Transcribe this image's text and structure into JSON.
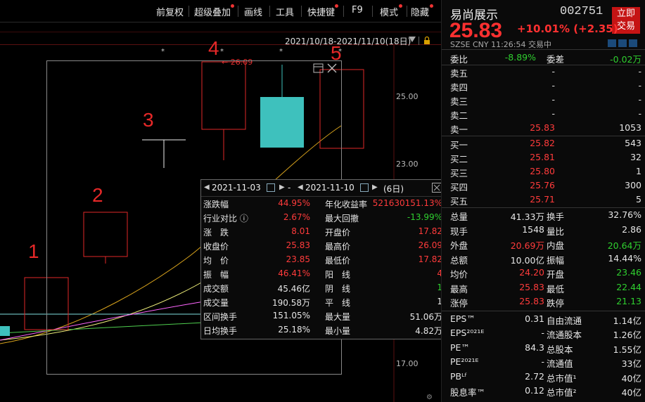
{
  "toolbar": {
    "items": [
      "前复权",
      "超级叠加",
      "画线",
      "工具",
      "快捷键",
      "F9",
      "模式",
      "隐藏"
    ]
  },
  "chart": {
    "range": "2021/10/18-2021/11/10(18日)",
    "price_labels": [
      "25.00",
      "23.00",
      "17.00"
    ],
    "marker_label": "← 26.09",
    "annotations": [
      "1",
      "2",
      "3",
      "4",
      "5"
    ]
  },
  "tooltip": {
    "start_date": "2021-11-03",
    "end_date": "2021-11-10",
    "sep": "-",
    "days": "(6日)",
    "rows": [
      {
        "l1": "涨跌幅",
        "v1": "44.95%",
        "c1": "red",
        "l2": "年化收益率",
        "v2": "521630151.13%",
        "c2": "red"
      },
      {
        "l1": "行业对比 ⓘ",
        "v1": "2.67%",
        "c1": "red",
        "l2": "最大回撤",
        "v2": "-13.99%",
        "c2": "green"
      },
      {
        "l1": "涨　跌",
        "v1": "8.01",
        "c1": "red",
        "l2": "开盘价",
        "v2": "17.82",
        "c2": "red"
      },
      {
        "l1": "收盘价",
        "v1": "25.83",
        "c1": "red",
        "l2": "最高价",
        "v2": "26.09",
        "c2": "red"
      },
      {
        "l1": "均　价",
        "v1": "23.85",
        "c1": "red",
        "l2": "最低价",
        "v2": "17.82",
        "c2": "red"
      },
      {
        "l1": "振　幅",
        "v1": "46.41%",
        "c1": "red",
        "l2": "阳　线",
        "v2": "4",
        "c2": "red"
      },
      {
        "l1": "成交额",
        "v1": "45.46亿",
        "c1": "wht",
        "l2": "阴　线",
        "v2": "1",
        "c2": "green"
      },
      {
        "l1": "成交量",
        "v1": "190.58万",
        "c1": "wht",
        "l2": "平　线",
        "v2": "1",
        "c2": "wht"
      },
      {
        "l1": "区间换手",
        "v1": "151.05%",
        "c1": "wht",
        "l2": "最大量",
        "v2": "51.06万",
        "c2": "wht"
      },
      {
        "l1": "日均换手",
        "v1": "25.18%",
        "c1": "wht",
        "l2": "最小量",
        "v2": "4.82万",
        "c2": "wht"
      }
    ]
  },
  "panel": {
    "name": "易尚展示",
    "code": "002751",
    "trade_btn": [
      "立即",
      "交易"
    ],
    "price": "25.83",
    "change": "+10.01%  (+2.35)",
    "sub": "SZSE  CNY  11:26:54  交易中",
    "weibi": {
      "l": "委比",
      "v": "-8.89%",
      "l2": "委差",
      "v2": "-0.02万"
    },
    "sells": [
      {
        "l": "卖五",
        "p": "-",
        "v": "-"
      },
      {
        "l": "卖四",
        "p": "-",
        "v": "-"
      },
      {
        "l": "卖三",
        "p": "-",
        "v": "-"
      },
      {
        "l": "卖二",
        "p": "-",
        "v": "-"
      },
      {
        "l": "卖一",
        "p": "25.83",
        "v": "1053"
      }
    ],
    "buys": [
      {
        "l": "买一",
        "p": "25.82",
        "v": "543"
      },
      {
        "l": "买二",
        "p": "25.81",
        "v": "32"
      },
      {
        "l": "买三",
        "p": "25.80",
        "v": "1"
      },
      {
        "l": "买四",
        "p": "25.76",
        "v": "300"
      },
      {
        "l": "买五",
        "p": "25.71",
        "v": "5"
      }
    ],
    "stats": [
      {
        "l1": "总量",
        "v1": "41.33万",
        "c1": "wht",
        "l2": "换手",
        "v2": "32.76%",
        "c2": "wht"
      },
      {
        "l1": "现手",
        "v1": "1548",
        "c1": "wht",
        "l2": "量比",
        "v2": "2.86",
        "c2": "wht"
      },
      {
        "l1": "外盘",
        "v1": "20.69万",
        "c1": "red",
        "l2": "内盘",
        "v2": "20.64万",
        "c2": "green"
      },
      {
        "l1": "总额",
        "v1": "10.00亿",
        "c1": "wht",
        "l2": "振幅",
        "v2": "14.44%",
        "c2": "wht"
      },
      {
        "l1": "均价",
        "v1": "24.20",
        "c1": "red",
        "l2": "开盘",
        "v2": "23.46",
        "c2": "green"
      },
      {
        "l1": "最高",
        "v1": "25.83",
        "c1": "red",
        "l2": "最低",
        "v2": "22.44",
        "c2": "green"
      },
      {
        "l1": "涨停",
        "v1": "25.83",
        "c1": "red",
        "l2": "跌停",
        "v2": "21.13",
        "c2": "green"
      }
    ],
    "fund": [
      {
        "l1": "EPS™",
        "v1": "0.31",
        "l2": "自由流通",
        "v2": "1.14亿"
      },
      {
        "l1": "EPS²⁰²¹ᴱ",
        "v1": "-",
        "l2": "流通股本",
        "v2": "1.26亿"
      },
      {
        "l1": "PE™",
        "v1": "84.3",
        "l2": "总股本",
        "v2": "1.55亿"
      },
      {
        "l1": "PE²⁰²¹ᴱ",
        "v1": "-",
        "l2": "流通值",
        "v2": "33亿"
      },
      {
        "l1": "PBᴸᶠ",
        "v1": "2.72",
        "l2": "总市值¹",
        "v2": "40亿"
      },
      {
        "l1": "股息率™",
        "v1": "0.12",
        "l2": "总市值²",
        "v2": "40亿"
      }
    ]
  }
}
